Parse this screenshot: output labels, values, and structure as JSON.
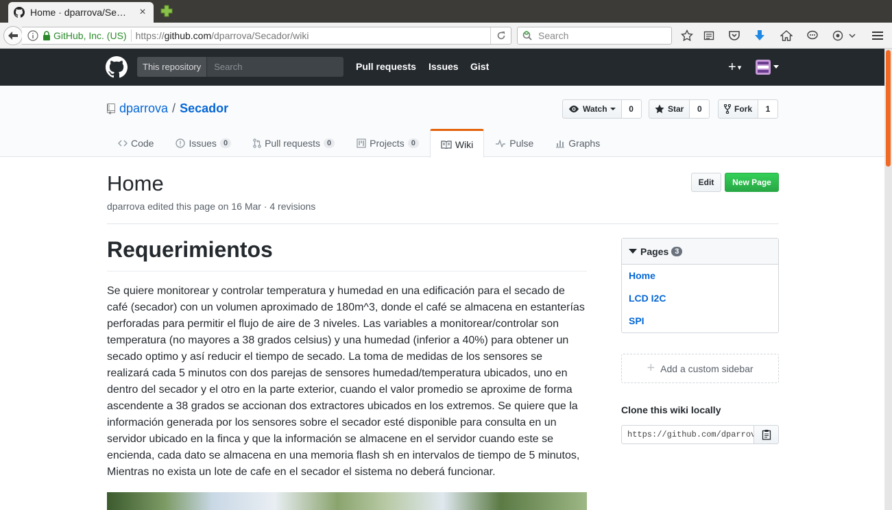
{
  "browser": {
    "tab_title": "Home · dparrova/Se…",
    "tab_close": "×",
    "identity": "GitHub, Inc. (US)",
    "url_prefix": "https://",
    "url_host": "github.com",
    "url_path": "/dparrova/Secador/wiki",
    "search_placeholder": "Search"
  },
  "github": {
    "scope_label": "This repository",
    "search_placeholder": "Search",
    "nav": {
      "pulls": "Pull requests",
      "issues": "Issues",
      "gist": "Gist"
    },
    "plus": "+",
    "plus_caret": "▾"
  },
  "repo": {
    "owner": "dparrova",
    "slash": "/",
    "name": "Secador",
    "watch_label": "Watch",
    "watch_count": "0",
    "star_label": "Star",
    "star_count": "0",
    "fork_label": "Fork",
    "fork_count": "1",
    "tabs": {
      "code": "Code",
      "issues": "Issues",
      "issues_count": "0",
      "pulls": "Pull requests",
      "pulls_count": "0",
      "projects": "Projects",
      "projects_count": "0",
      "wiki": "Wiki",
      "pulse": "Pulse",
      "graphs": "Graphs"
    }
  },
  "wiki": {
    "title": "Home",
    "meta": "dparrova edited this page on 16 Mar · 4 revisions",
    "edit_label": "Edit",
    "new_page_label": "New Page",
    "heading": "Requerimientos",
    "paragraph": "Se quiere monitorear y controlar temperatura y humedad en una edificación para el secado de café (secador) con un volumen aproximado de 180m^3, donde el café se almacena en estanterías perforadas para permitir el flujo de aire de 3 niveles. Las variables a monitorear/controlar son temperatura (no mayores a 38 grados celsius) y una humedad (inferior a 40%) para obtener un secado optimo y así reducir el tiempo de secado. La toma de medidas de los sensores se realizará cada 5 minutos con dos parejas de sensores humedad/temperatura ubicados, uno en dentro del secador y el otro en la parte exterior, cuando el valor promedio se aproxime de forma ascendente a 38 grados se accionan dos extractores ubicados en los extremos. Se quiere que la información generada por los sensores sobre el secador esté disponible para consulta en un servidor ubicado en la finca y que la información se almacene en el servidor cuando este se encienda, cada dato se almacena en una memoria flash sh en intervalos de tiempo de 5 minutos, Mientras no exista un lote de cafe en el secador el sistema no deberá funcionar."
  },
  "sidebar": {
    "pages_label": "Pages",
    "pages_count": "3",
    "pages": [
      "Home",
      "LCD I2C",
      "SPI"
    ],
    "add_sidebar": "Add a custom sidebar",
    "add_plus": "+",
    "clone_title": "Clone this wiki locally",
    "clone_url": "https://github.com/dparrova/Secador.wiki.git"
  }
}
